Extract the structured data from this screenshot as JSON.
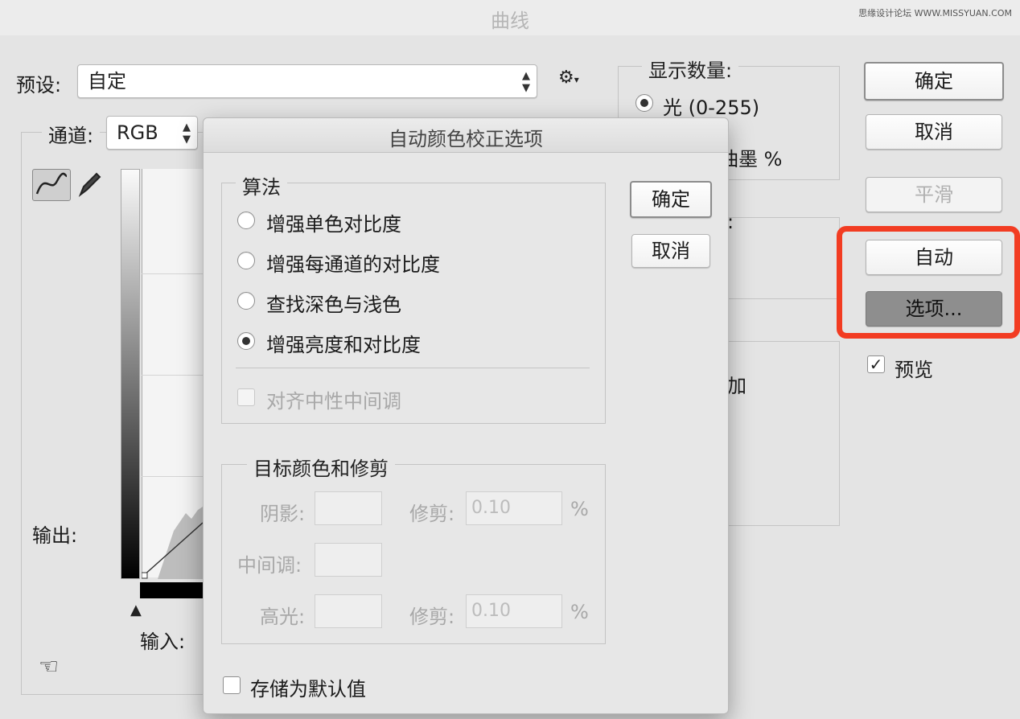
{
  "window": {
    "title": "曲线",
    "watermark": "思缘设计论坛 WWW.MISSYUAN.COM"
  },
  "curves": {
    "preset_label": "预设:",
    "preset_value": "自定",
    "channel_label": "通道:",
    "channel_value": "RGB",
    "output_label": "输出:",
    "input_label": "输入:",
    "display_amount": {
      "title": "显示数量:",
      "option_light": "光 (0-255)",
      "option_pigment_partial": "油墨 %",
      "light_selected": true
    },
    "partial_label_colon": ":",
    "partial_label_add": "加",
    "buttons": {
      "ok": "确定",
      "cancel": "取消",
      "smooth": "平滑",
      "auto": "自动",
      "options": "选项..."
    },
    "preview_label": "预览",
    "preview_checked": true
  },
  "dialog": {
    "title": "自动颜色校正选项",
    "ok": "确定",
    "cancel": "取消",
    "algorithms": {
      "legend": "算法",
      "options": [
        {
          "label": "增强单色对比度",
          "selected": false
        },
        {
          "label": "增强每通道的对比度",
          "selected": false
        },
        {
          "label": "查找深色与浅色",
          "selected": false
        },
        {
          "label": "增强亮度和对比度",
          "selected": true
        }
      ],
      "snap_neutral": "对齐中性中间调"
    },
    "target": {
      "legend": "目标颜色和修剪",
      "shadows_label": "阴影:",
      "midtones_label": "中间调:",
      "highlights_label": "高光:",
      "clip_label": "修剪:",
      "shadow_clip": "0.10",
      "highlight_clip": "0.10",
      "percent": "%"
    },
    "save_default": "存储为默认值"
  },
  "colors": {
    "highlight_box": "#f23c22"
  }
}
